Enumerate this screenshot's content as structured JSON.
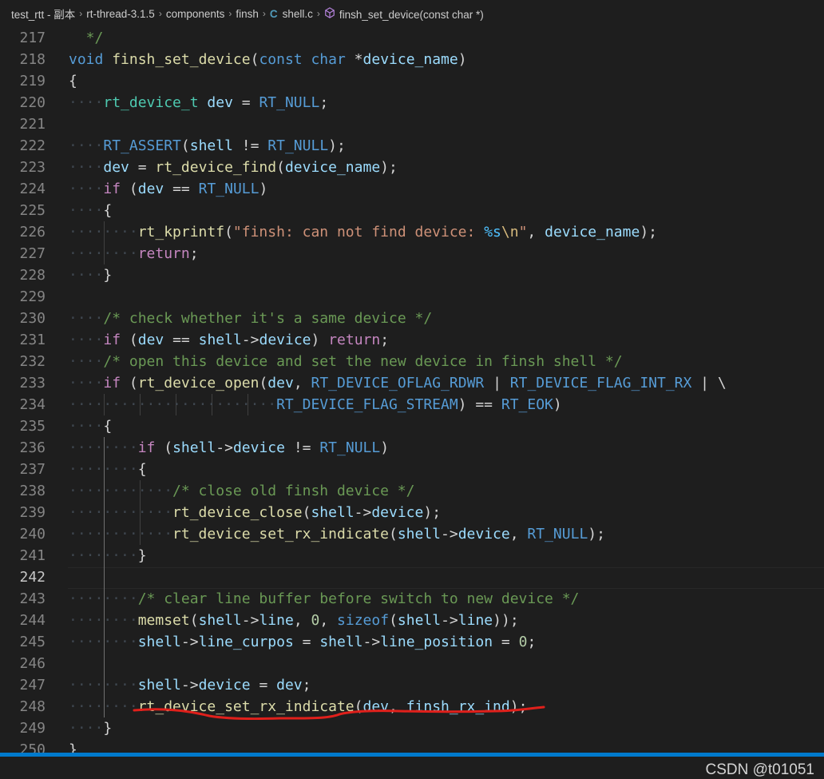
{
  "breadcrumb": {
    "items": [
      "test_rtt - 副本",
      "rt-thread-3.1.5",
      "components",
      "finsh",
      "shell.c",
      "finsh_set_device(const char *)"
    ],
    "file_icon": "c-file-icon",
    "symbol_icon": "function-cube-icon"
  },
  "editor": {
    "first_line": 217,
    "current_line": 242,
    "lines": [
      [
        [
          "cm",
          "  */"
        ]
      ],
      [
        [
          "k",
          "void"
        ],
        [
          "p",
          " "
        ],
        [
          "f",
          "finsh_set_device"
        ],
        [
          "p",
          "("
        ],
        [
          "k",
          "const"
        ],
        [
          "p",
          " "
        ],
        [
          "k",
          "char"
        ],
        [
          "p",
          " *"
        ],
        [
          "v",
          "device_name"
        ],
        [
          "p",
          ")"
        ]
      ],
      [
        [
          "p",
          "{"
        ]
      ],
      [
        [
          "ws",
          "····"
        ],
        [
          "t",
          "rt_device_t"
        ],
        [
          "p",
          " "
        ],
        [
          "v",
          "dev"
        ],
        [
          "p",
          " = "
        ],
        [
          "k",
          "RT_NULL"
        ],
        [
          "p",
          ";"
        ]
      ],
      [],
      [
        [
          "ws",
          "····"
        ],
        [
          "k",
          "RT_ASSERT"
        ],
        [
          "p",
          "("
        ],
        [
          "v",
          "shell"
        ],
        [
          "p",
          " != "
        ],
        [
          "k",
          "RT_NULL"
        ],
        [
          "p",
          ");"
        ]
      ],
      [
        [
          "ws",
          "····"
        ],
        [
          "v",
          "dev"
        ],
        [
          "p",
          " = "
        ],
        [
          "f",
          "rt_device_find"
        ],
        [
          "p",
          "("
        ],
        [
          "v",
          "device_name"
        ],
        [
          "p",
          ");"
        ]
      ],
      [
        [
          "ws",
          "····"
        ],
        [
          "c",
          "if"
        ],
        [
          "p",
          " ("
        ],
        [
          "v",
          "dev"
        ],
        [
          "p",
          " == "
        ],
        [
          "k",
          "RT_NULL"
        ],
        [
          "p",
          ")"
        ]
      ],
      [
        [
          "ws",
          "····"
        ],
        [
          "p",
          "{"
        ]
      ],
      [
        [
          "ws",
          "········"
        ],
        [
          "f",
          "rt_kprintf"
        ],
        [
          "p",
          "("
        ],
        [
          "s",
          "\"finsh: can not find device: "
        ],
        [
          "m",
          "%s"
        ],
        [
          "e",
          "\\n"
        ],
        [
          "s",
          "\""
        ],
        [
          "p",
          ", "
        ],
        [
          "v",
          "device_name"
        ],
        [
          "p",
          ");"
        ]
      ],
      [
        [
          "ws",
          "········"
        ],
        [
          "c",
          "return"
        ],
        [
          "p",
          ";"
        ]
      ],
      [
        [
          "ws",
          "····"
        ],
        [
          "p",
          "}"
        ]
      ],
      [],
      [
        [
          "ws",
          "····"
        ],
        [
          "cm",
          "/* check whether it's a same device */"
        ]
      ],
      [
        [
          "ws",
          "····"
        ],
        [
          "c",
          "if"
        ],
        [
          "p",
          " ("
        ],
        [
          "v",
          "dev"
        ],
        [
          "p",
          " == "
        ],
        [
          "v",
          "shell"
        ],
        [
          "p",
          "->"
        ],
        [
          "v",
          "device"
        ],
        [
          "p",
          ") "
        ],
        [
          "c",
          "return"
        ],
        [
          "p",
          ";"
        ]
      ],
      [
        [
          "ws",
          "····"
        ],
        [
          "cm",
          "/* open this device and set the new device in finsh shell */"
        ]
      ],
      [
        [
          "ws",
          "····"
        ],
        [
          "c",
          "if"
        ],
        [
          "p",
          " ("
        ],
        [
          "f",
          "rt_device_open"
        ],
        [
          "p",
          "("
        ],
        [
          "v",
          "dev"
        ],
        [
          "p",
          ", "
        ],
        [
          "k",
          "RT_DEVICE_OFLAG_RDWR"
        ],
        [
          "p",
          " | "
        ],
        [
          "k",
          "RT_DEVICE_FLAG_INT_RX"
        ],
        [
          "p",
          " | \\"
        ]
      ],
      [
        [
          "ws",
          "························"
        ],
        [
          "k",
          "RT_DEVICE_FLAG_STREAM"
        ],
        [
          "p",
          ") == "
        ],
        [
          "k",
          "RT_EOK"
        ],
        [
          "p",
          ")"
        ]
      ],
      [
        [
          "ws",
          "····"
        ],
        [
          "p",
          "{"
        ]
      ],
      [
        [
          "ws",
          "········"
        ],
        [
          "c",
          "if"
        ],
        [
          "p",
          " ("
        ],
        [
          "v",
          "shell"
        ],
        [
          "p",
          "->"
        ],
        [
          "v",
          "device"
        ],
        [
          "p",
          " != "
        ],
        [
          "k",
          "RT_NULL"
        ],
        [
          "p",
          ")"
        ]
      ],
      [
        [
          "ws",
          "········"
        ],
        [
          "p",
          "{"
        ]
      ],
      [
        [
          "ws",
          "············"
        ],
        [
          "cm",
          "/* close old finsh device */"
        ]
      ],
      [
        [
          "ws",
          "············"
        ],
        [
          "f",
          "rt_device_close"
        ],
        [
          "p",
          "("
        ],
        [
          "v",
          "shell"
        ],
        [
          "p",
          "->"
        ],
        [
          "v",
          "device"
        ],
        [
          "p",
          ");"
        ]
      ],
      [
        [
          "ws",
          "············"
        ],
        [
          "f",
          "rt_device_set_rx_indicate"
        ],
        [
          "p",
          "("
        ],
        [
          "v",
          "shell"
        ],
        [
          "p",
          "->"
        ],
        [
          "v",
          "device"
        ],
        [
          "p",
          ", "
        ],
        [
          "k",
          "RT_NULL"
        ],
        [
          "p",
          ");"
        ]
      ],
      [
        [
          "ws",
          "········"
        ],
        [
          "p",
          "}"
        ]
      ],
      [],
      [
        [
          "ws",
          "········"
        ],
        [
          "cm",
          "/* clear line buffer before switch to new device */"
        ]
      ],
      [
        [
          "ws",
          "········"
        ],
        [
          "f",
          "memset"
        ],
        [
          "p",
          "("
        ],
        [
          "v",
          "shell"
        ],
        [
          "p",
          "->"
        ],
        [
          "v",
          "line"
        ],
        [
          "p",
          ", "
        ],
        [
          "n",
          "0"
        ],
        [
          "p",
          ", "
        ],
        [
          "k",
          "sizeof"
        ],
        [
          "p",
          "("
        ],
        [
          "v",
          "shell"
        ],
        [
          "p",
          "->"
        ],
        [
          "v",
          "line"
        ],
        [
          "p",
          "));"
        ]
      ],
      [
        [
          "ws",
          "········"
        ],
        [
          "v",
          "shell"
        ],
        [
          "p",
          "->"
        ],
        [
          "v",
          "line_curpos"
        ],
        [
          "p",
          " = "
        ],
        [
          "v",
          "shell"
        ],
        [
          "p",
          "->"
        ],
        [
          "v",
          "line_position"
        ],
        [
          "p",
          " = "
        ],
        [
          "n",
          "0"
        ],
        [
          "p",
          ";"
        ]
      ],
      [],
      [
        [
          "ws",
          "········"
        ],
        [
          "v",
          "shell"
        ],
        [
          "p",
          "->"
        ],
        [
          "v",
          "device"
        ],
        [
          "p",
          " = "
        ],
        [
          "v",
          "dev"
        ],
        [
          "p",
          ";"
        ]
      ],
      [
        [
          "ws",
          "········"
        ],
        [
          "f",
          "rt_device_set_rx_indicate"
        ],
        [
          "p",
          "("
        ],
        [
          "v",
          "dev"
        ],
        [
          "p",
          ", "
        ],
        [
          "v",
          "finsh_rx_ind"
        ],
        [
          "p",
          ");"
        ]
      ],
      [
        [
          "ws",
          "····"
        ],
        [
          "p",
          "}"
        ]
      ],
      [
        [
          "p",
          "}"
        ]
      ]
    ]
  },
  "annotation": {
    "color": "#e0201b"
  },
  "watermark": "CSDN @t01051",
  "colors": {
    "background": "#1e1e1e",
    "status_bar": "#007acc"
  }
}
